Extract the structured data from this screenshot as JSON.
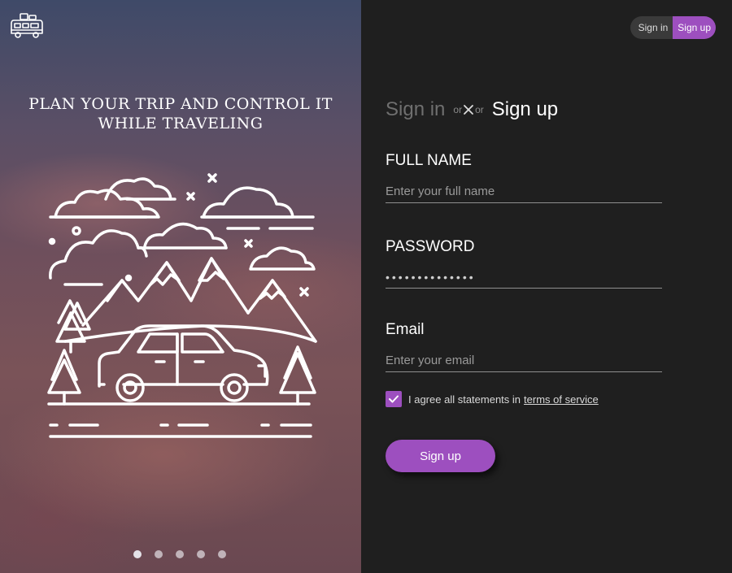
{
  "left": {
    "headline_line1": "Plan your trip and control it",
    "headline_line2": "while traveling",
    "logo_icon": "travel-bus-icon",
    "illustration_icon": "car-mountains-illustration",
    "carousel": {
      "count": 5,
      "active_index": 0
    }
  },
  "toggle": {
    "signin_label": "Sign in",
    "signup_label": "Sign up"
  },
  "title": {
    "signin": "Sign in",
    "or_left": "or",
    "or_right": "or",
    "signup": "Sign up"
  },
  "form": {
    "fullname_label": "FULL NAME",
    "fullname_placeholder": "Enter your full name",
    "password_label": "PASSWORD",
    "password_value": "••••••••••••••",
    "email_label": "Email",
    "email_placeholder": "Enter your email",
    "agree_text": "I agree all statements in",
    "terms_link": "terms of service",
    "agree_checked": true,
    "submit_label": "Sign up"
  },
  "colors": {
    "accent": "#9d4fbf",
    "panel_bg": "#1f1f1f"
  }
}
